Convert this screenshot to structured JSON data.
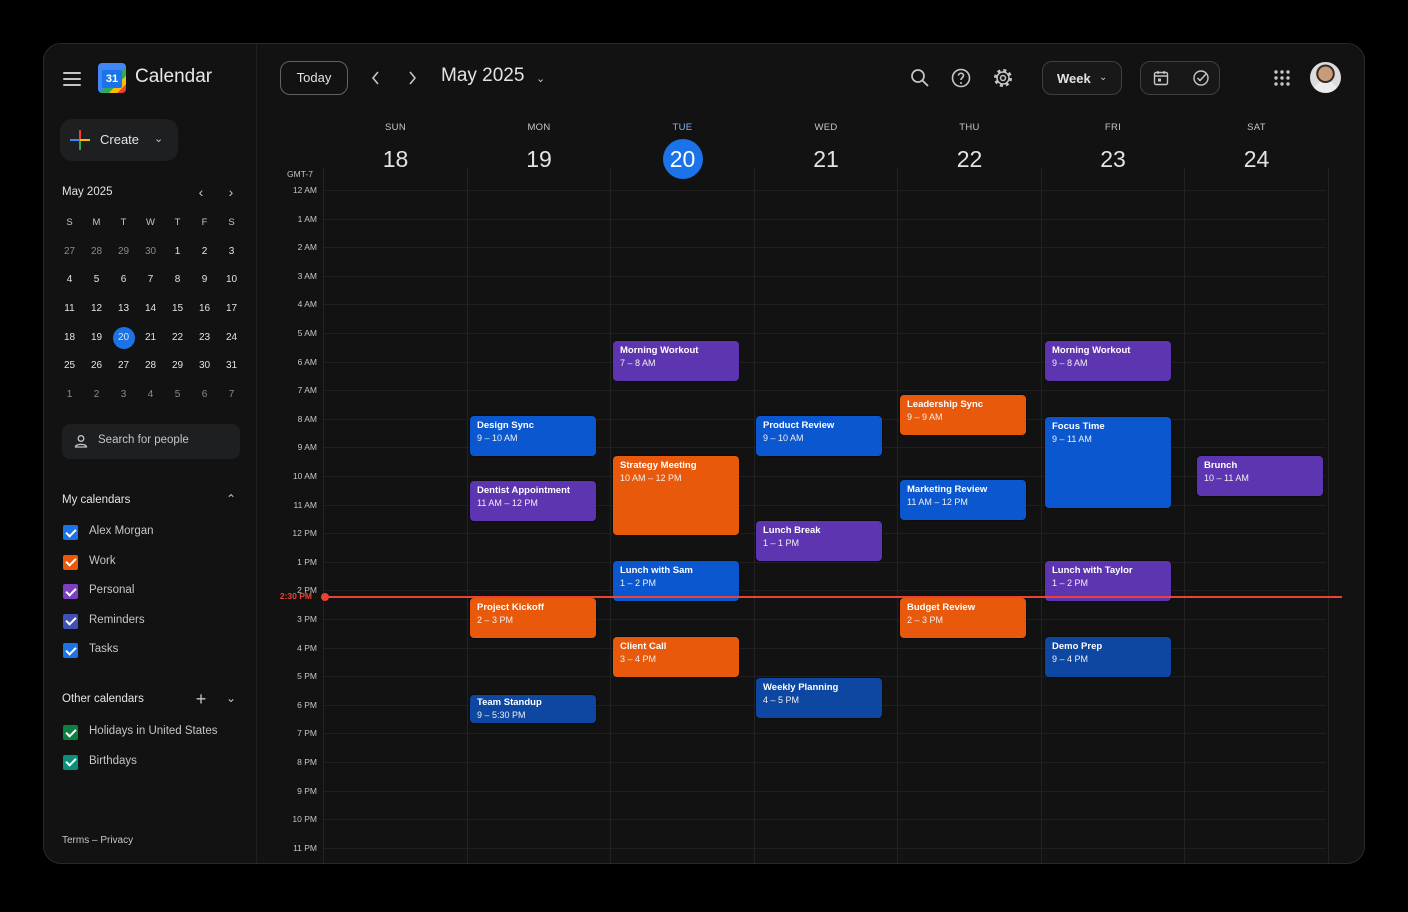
{
  "app": {
    "title": "Calendar",
    "logo_text": "31"
  },
  "sidebar": {
    "create_label": "Create",
    "mini_calendar": {
      "title": "May 2025",
      "weekday_heads": [
        "S",
        "M",
        "T",
        "W",
        "T",
        "F",
        "S"
      ],
      "weeks": [
        [
          "27",
          "28",
          "29",
          "30",
          "1",
          "2",
          "3"
        ],
        [
          "4",
          "5",
          "6",
          "7",
          "8",
          "9",
          "10"
        ],
        [
          "11",
          "12",
          "13",
          "14",
          "15",
          "16",
          "17"
        ],
        [
          "18",
          "19",
          "20",
          "21",
          "22",
          "23",
          "24"
        ],
        [
          "25",
          "26",
          "27",
          "28",
          "29",
          "30",
          "31"
        ],
        [
          "1",
          "2",
          "3",
          "4",
          "5",
          "6",
          "7"
        ]
      ],
      "today": "20"
    },
    "search_people_placeholder": "Search for people",
    "my_calendars": {
      "title": "My calendars",
      "items": [
        {
          "label": "Alex Morgan",
          "color": "#1a73e8",
          "checked": true
        },
        {
          "label": "Work",
          "color": "#e8590c",
          "checked": true
        },
        {
          "label": "Personal",
          "color": "#7b3fbf",
          "checked": true
        },
        {
          "label": "Reminders",
          "color": "#3f51b5",
          "checked": true
        },
        {
          "label": "Tasks",
          "color": "#1a73e8",
          "checked": true
        }
      ]
    },
    "other_calendars": {
      "title": "Other calendars",
      "items": [
        {
          "label": "Holidays in United States",
          "color": "#0b8043",
          "checked": true
        },
        {
          "label": "Birthdays",
          "color": "#0b8f7a",
          "checked": true
        }
      ]
    },
    "footer": "Terms – Privacy"
  },
  "header": {
    "today_label": "Today",
    "month_label": "May 2025",
    "view_label": "Week",
    "icons": [
      "search-icon",
      "help-icon",
      "settings-icon",
      "calendar-toggle-icon",
      "tasks-toggle-icon",
      "apps-grid-icon"
    ]
  },
  "week": {
    "timezone": "GMT-7",
    "days": [
      {
        "name": "SUN",
        "num": "18"
      },
      {
        "name": "MON",
        "num": "19"
      },
      {
        "name": "TUE",
        "num": "20",
        "today": true
      },
      {
        "name": "WED",
        "num": "21"
      },
      {
        "name": "THU",
        "num": "22"
      },
      {
        "name": "FRI",
        "num": "23"
      },
      {
        "name": "SAT",
        "num": "24"
      }
    ],
    "hours": [
      "12 AM",
      "1 AM",
      "2 AM",
      "3 AM",
      "4 AM",
      "5 AM",
      "6 AM",
      "7 AM",
      "8 AM",
      "9 AM",
      "10 AM",
      "11 AM",
      "12 PM",
      "1 PM",
      "2 PM",
      "3 PM",
      "4 PM",
      "5 PM",
      "6 PM",
      "7 PM",
      "8 PM",
      "9 PM",
      "10 PM",
      "11 PM"
    ],
    "now_label": "2:30 PM",
    "events": [
      {
        "title": "Morning Workout",
        "time": "7 – 8 AM",
        "color": "purple"
      },
      {
        "title": "Morning Workout",
        "time": "9 – 8 AM",
        "color": "purple"
      },
      {
        "title": "Leadership Sync",
        "time": "9 – 9 AM",
        "color": "orange"
      },
      {
        "title": "Design Sync",
        "time": "9 – 10 AM",
        "color": "blue"
      },
      {
        "title": "Product Review",
        "time": "9 – 10 AM",
        "color": "blue"
      },
      {
        "title": "Focus Time",
        "time": "9 – 11 AM",
        "color": "blue"
      },
      {
        "title": "Strategy Meeting",
        "time": "10 AM – 12 PM",
        "color": "orange"
      },
      {
        "title": "Brunch",
        "time": "10 – 11 AM",
        "color": "purple"
      },
      {
        "title": "Dentist Appointment",
        "time": "11 AM – 12 PM",
        "color": "purple"
      },
      {
        "title": "Marketing Review",
        "time": "11 AM – 12 PM",
        "color": "blue"
      },
      {
        "title": "Lunch Break",
        "time": "1 – 1 PM",
        "color": "purple"
      },
      {
        "title": "Lunch with Sam",
        "time": "1 – 2 PM",
        "color": "blue"
      },
      {
        "title": "Lunch with Taylor",
        "time": "1 – 2 PM",
        "color": "purple"
      },
      {
        "title": "Project Kickoff",
        "time": "2 – 3 PM",
        "color": "orange"
      },
      {
        "title": "Budget Review",
        "time": "2 – 3 PM",
        "color": "orange"
      },
      {
        "title": "Client Call",
        "time": "3 – 4 PM",
        "color": "orange"
      },
      {
        "title": "Demo Prep",
        "time": "9 – 4 PM",
        "color": "dblue"
      },
      {
        "title": "Weekly Planning",
        "time": "4 – 5 PM",
        "color": "dblue"
      },
      {
        "title": "Team Standup",
        "time": "9 – 5:30 PM",
        "color": "dblue"
      }
    ]
  }
}
